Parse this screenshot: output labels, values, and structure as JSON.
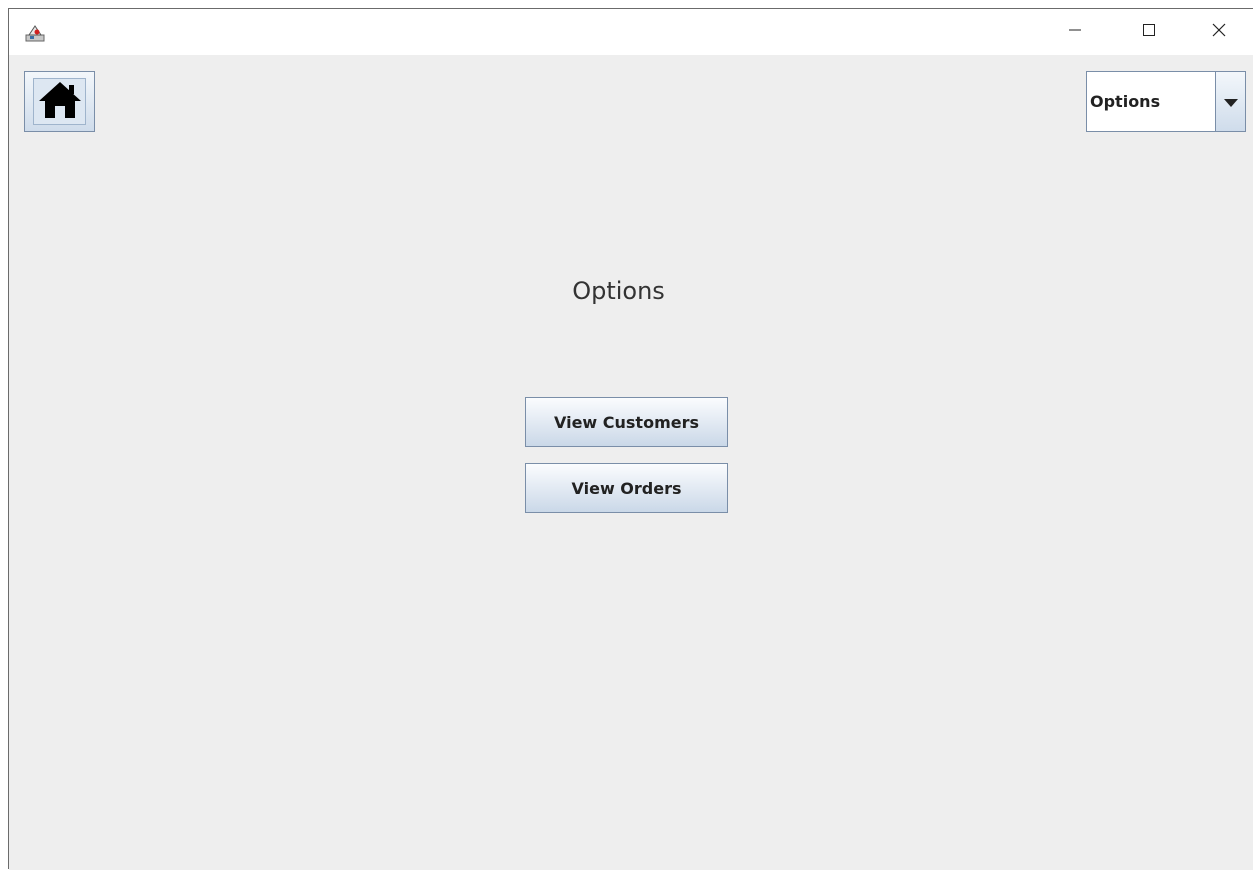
{
  "window": {
    "app_icon": "java-app-icon",
    "controls": {
      "minimize_icon": "minimize-icon",
      "maximize_icon": "maximize-icon",
      "close_icon": "close-icon"
    }
  },
  "toolbar": {
    "home_icon": "home-icon",
    "options_select": {
      "selected": "Options",
      "arrow_icon": "chevron-down-icon"
    }
  },
  "main": {
    "title": "Options",
    "buttons": {
      "view_customers": "View Customers",
      "view_orders": "View Orders"
    }
  },
  "colors": {
    "background": "#eeeeee",
    "button_border": "#7a8ea8",
    "button_gradient_top": "#fbfcfe",
    "button_gradient_bottom": "#cad8e8"
  }
}
